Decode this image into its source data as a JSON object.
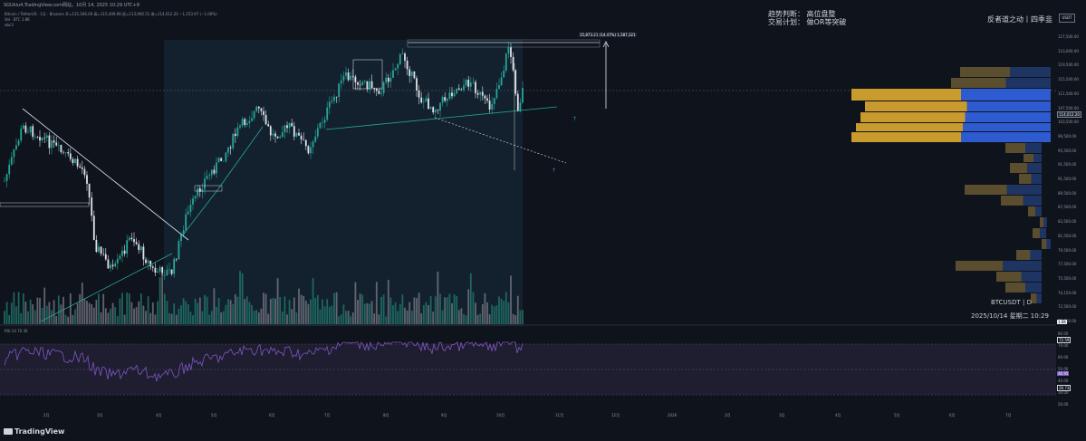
{
  "header": {
    "snapshot": "SGUkiu4,TradingView.com网站，10月 14, 2025 10:29 UTC+8",
    "legend_line1": "Bitcoin / TetherUS · 1天 · Binance  开=115,166.00  高=115,409.96  低=113,900.51  收=114,012.20  −1,153.97 (−1.00%)",
    "legend_line2": "Vol · BTC   1.8K",
    "legend_line3": "abc3"
  },
  "annotation": {
    "trend": "趋势判断：   高位盘整",
    "plan": "交易计划：  做OR等突破",
    "author": "反者道之动丨四季韭",
    "currency": "USDT",
    "symbol": "BTCUSDT  |  D",
    "datetime": "2025/10/14 星期二  10:29",
    "measure": "15,873.21 (14.47%) 1,587,321"
  },
  "price_axis": {
    "ticks": [
      "127,500.00",
      "123,000.00",
      "119,500.00",
      "115,500.00",
      "111,500.00",
      "107,500.00",
      "103,500.00",
      "99,500.00",
      "95,500.00",
      "91,500.00",
      "91,500.00",
      "89,500.00",
      "87,500.00",
      "83,500.00",
      "81,500.00",
      "79,500.00",
      "77,500.00",
      "75,500.00",
      "74,150.00",
      "72,500.00",
      "71,000.00"
    ],
    "current_price": "114,012.20",
    "volume_badge": "1.8K"
  },
  "rsi": {
    "label": "RSI  14  70  30",
    "ticks": [
      "80.00",
      "70.00",
      "60.00",
      "50.00",
      "40.00",
      "30.00",
      "20.00"
    ],
    "badge_high": "72.59",
    "badge_mid": "46.95",
    "badge_low": "26.73",
    "colors": {
      "line": "#7e57c2",
      "band": "#2a2440"
    }
  },
  "time_axis": {
    "months": [
      "2月",
      "3月",
      "4月",
      "5月",
      "6月",
      "7月",
      "8月",
      "9月",
      "10月",
      "11月",
      "12月",
      "2026",
      "2月",
      "3月",
      "4月",
      "5月",
      "6月",
      "7月"
    ]
  },
  "footer": {
    "brand": "TradingView"
  },
  "colors": {
    "up": "#26a69a",
    "down": "#e0e3eb",
    "vp_left": "#c99a2e",
    "vp_right": "#2f5bd1"
  }
}
